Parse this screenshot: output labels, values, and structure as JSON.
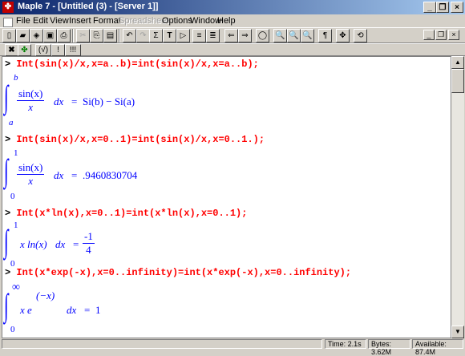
{
  "window": {
    "title": "Maple 7 - [Untitled (3) - [Server 1]]",
    "app_icon": "maple-leaf-icon"
  },
  "menu": [
    "File",
    "Edit",
    "View",
    "Insert",
    "Format",
    "Spreadsheet",
    "Options",
    "Window",
    "Help"
  ],
  "menu_disabled": [
    "Spreadsheet"
  ],
  "toolbar2": {
    "exec_label": "(√)",
    "bang_label": "!",
    "triple_label": "!!!"
  },
  "worksheet": {
    "prompt_symbol": ">",
    "inputs": [
      "Int(sin(x)/x,x=a..b)=int(sin(x)/x,x=a..b);",
      "Int(sin(x)/x,x=0..1)=int(sin(x)/x,x=0..1.);",
      "Int(x*ln(x),x=0..1)=int(x*ln(x),x=0..1);",
      "Int(x*exp(-x),x=0..infinity)=int(x*exp(-x),x=0..infinity);"
    ],
    "outputs": [
      {
        "upper": "b",
        "lower": "a",
        "num": "sin(x)",
        "den": "x",
        "dx": "dx",
        "eq": "=",
        "result": "Si(b) − Si(a)"
      },
      {
        "upper": "1",
        "lower": "0",
        "num": "sin(x)",
        "den": "x",
        "dx": "dx",
        "eq": "=",
        "result": ".9460830704"
      },
      {
        "upper": "1",
        "lower": "0",
        "integrand": "x ln(x)",
        "dx": "dx",
        "eq": "=",
        "res_num": "-1",
        "res_den": "4"
      },
      {
        "upper": "∞",
        "lower": "0",
        "integrand": "x e",
        "exponent": "(−x)",
        "dx": "dx",
        "eq": "=",
        "result": "1"
      }
    ]
  },
  "status": {
    "blank": "",
    "time": "Time:   2.1s",
    "bytes": "Bytes: 3.62M",
    "available": "Available: 87.4M"
  },
  "colors": {
    "input": "#ff0000",
    "output": "#0000ff",
    "title_start": "#0a246a",
    "title_end": "#a6caf0"
  }
}
